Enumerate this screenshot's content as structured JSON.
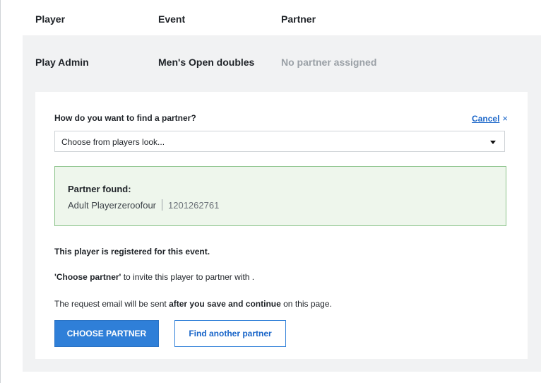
{
  "table": {
    "headers": {
      "player": "Player",
      "event": "Event",
      "partner": "Partner"
    },
    "row": {
      "player": "Play Admin",
      "event": "Men's Open doubles",
      "partner": "No partner assigned"
    }
  },
  "finder": {
    "question": "How do you want to find a partner?",
    "cancel_label": "Cancel",
    "cancel_icon": "×",
    "select_value": "Choose from players look...",
    "found_title": "Partner found:",
    "found_name": "Adult Playerzeroofour",
    "found_id": "1201262761",
    "registered_msg": "This player is registered for this event.",
    "invite_bold": "'Choose partner'",
    "invite_rest": " to invite this player to partner with .",
    "email_prefix": "The request email will be sent ",
    "email_bold": "after you save and continue",
    "email_suffix": " on this page.",
    "choose_button": "CHOOSE PARTNER",
    "find_another_button": "Find another partner"
  },
  "colors": {
    "primary": "#2f7fd8",
    "success_border": "#8bc38a",
    "success_bg": "#eef6ec",
    "panel_bg": "#f1f2f3"
  }
}
